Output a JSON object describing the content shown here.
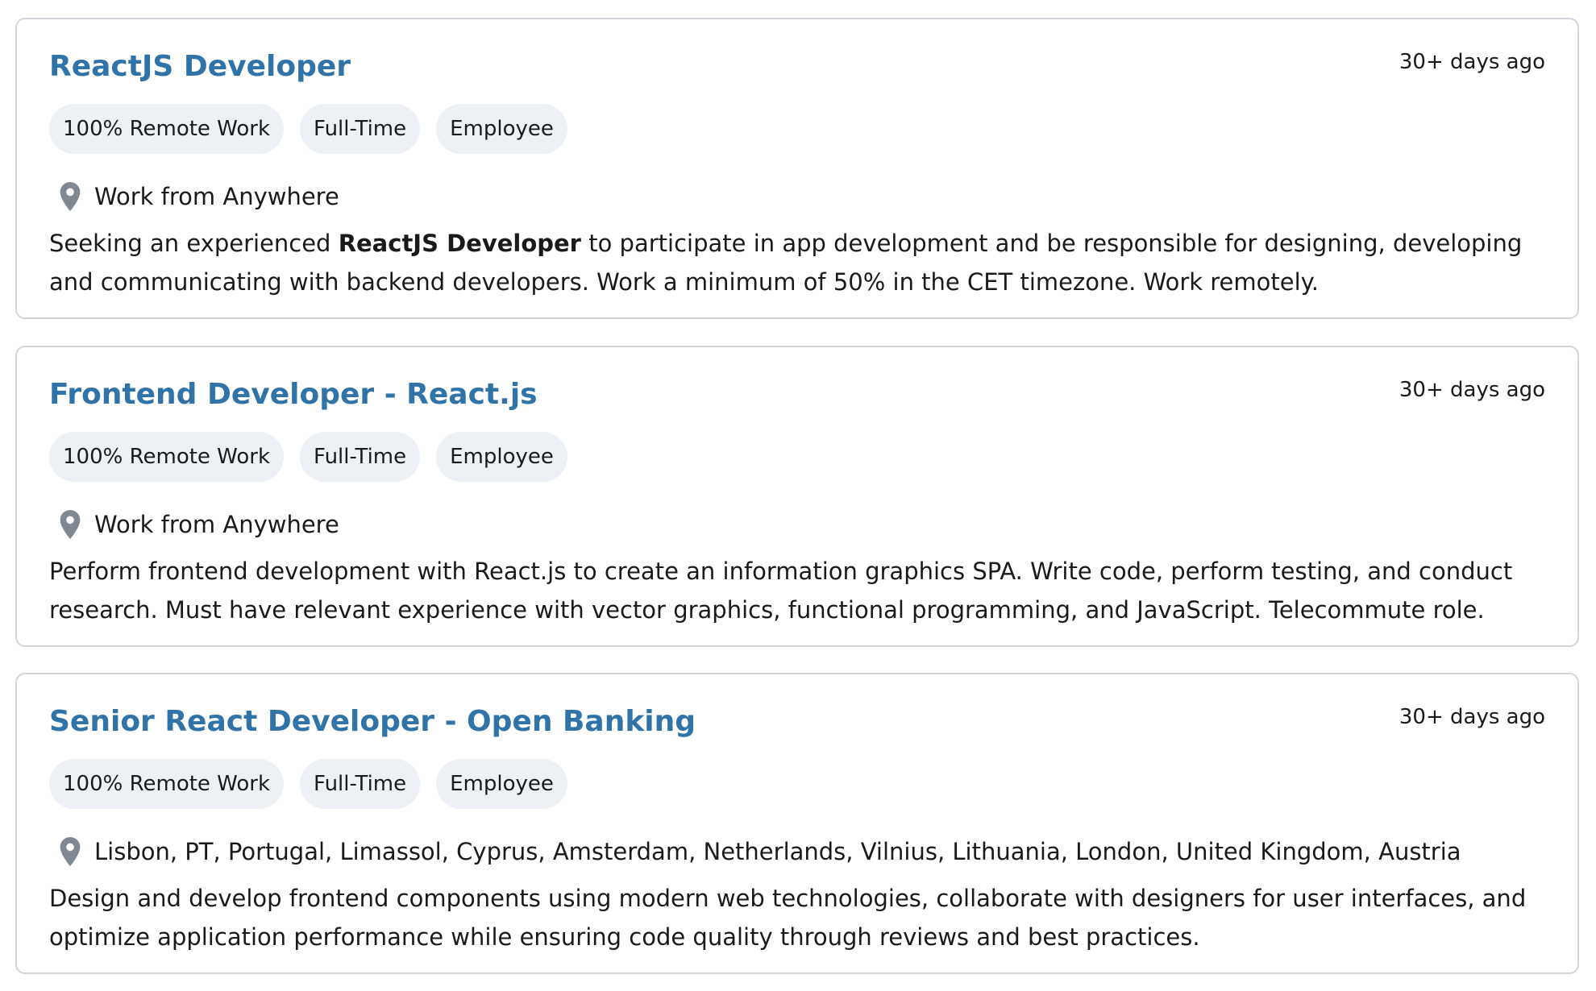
{
  "jobs": [
    {
      "title": "ReactJS Developer",
      "posted": "30+ days ago",
      "tags": [
        "100% Remote Work",
        "Full-Time",
        "Employee"
      ],
      "location": "Work from Anywhere",
      "description_before": "Seeking an experienced ",
      "description_bold": "ReactJS Developer",
      "description_after": " to participate in app development and be responsible for designing, developing and communicating with backend developers. Work a minimum of 50% in the CET timezone. Work remotely."
    },
    {
      "title": "Frontend Developer - React.js",
      "posted": "30+ days ago",
      "tags": [
        "100% Remote Work",
        "Full-Time",
        "Employee"
      ],
      "location": "Work from Anywhere",
      "description": "Perform frontend development with React.js to create an information graphics SPA. Write code, perform testing, and conduct research. Must have relevant experience with vector graphics, functional programming, and JavaScript. Telecommute role."
    },
    {
      "title": "Senior React Developer - Open Banking",
      "posted": "30+ days ago",
      "tags": [
        "100% Remote Work",
        "Full-Time",
        "Employee"
      ],
      "location": "Lisbon, PT, Portugal, Limassol, Cyprus, Amsterdam, Netherlands, Vilnius, Lithuania, London, United Kingdom, Austria,...",
      "description": "Design and develop frontend components using modern web technologies, collaborate with designers for user interfaces, and optimize application performance while ensuring code quality through reviews and best practices."
    }
  ],
  "icons": {
    "location": "location-pin-icon"
  },
  "colors": {
    "title": "#2f73a8",
    "tag_background": "#edf0f4",
    "card_border": "#d2d6dc",
    "pin": "#808892"
  }
}
